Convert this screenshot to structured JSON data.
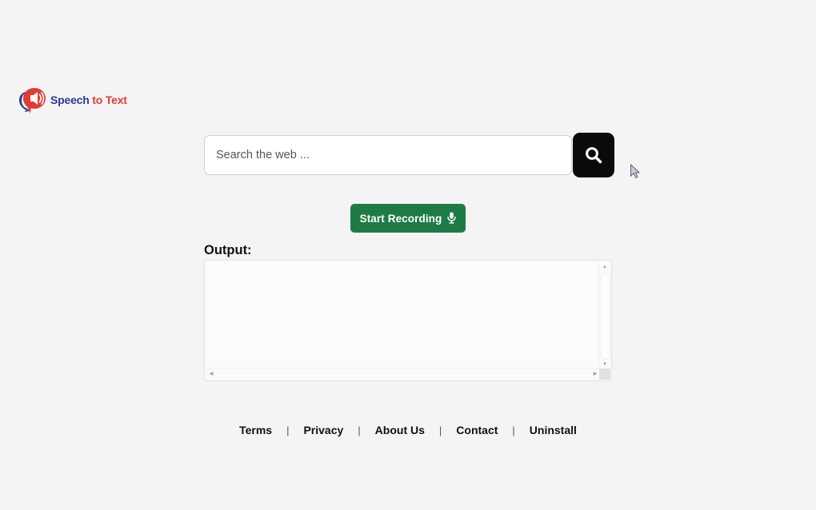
{
  "page": {
    "background_color": "#f4f4f4"
  },
  "logo": {
    "icon_name": "speech-bubble-speaker-icon",
    "word_speech": "Speech",
    "word_to": " to ",
    "word_text": "Text",
    "speech_color": "#2b3a8f",
    "accent_color": "#e23b33"
  },
  "search": {
    "placeholder": "Search the web ...",
    "value": "",
    "button_icon": "search-icon",
    "button_color": "#0a0a0a"
  },
  "record": {
    "label": "Start Recording",
    "mic_glyph": "🎤",
    "color": "#1e7b46"
  },
  "output": {
    "label": "Output:",
    "value": "",
    "placeholder": ""
  },
  "scrollbars": {
    "up_arrow": "▲",
    "down_arrow": "▼",
    "left_arrow": "◀",
    "right_arrow": "▶"
  },
  "footer": {
    "separator": "|",
    "links": [
      {
        "label": "Terms"
      },
      {
        "label": "Privacy"
      },
      {
        "label": "About Us"
      },
      {
        "label": "Contact"
      },
      {
        "label": "Uninstall"
      }
    ]
  }
}
